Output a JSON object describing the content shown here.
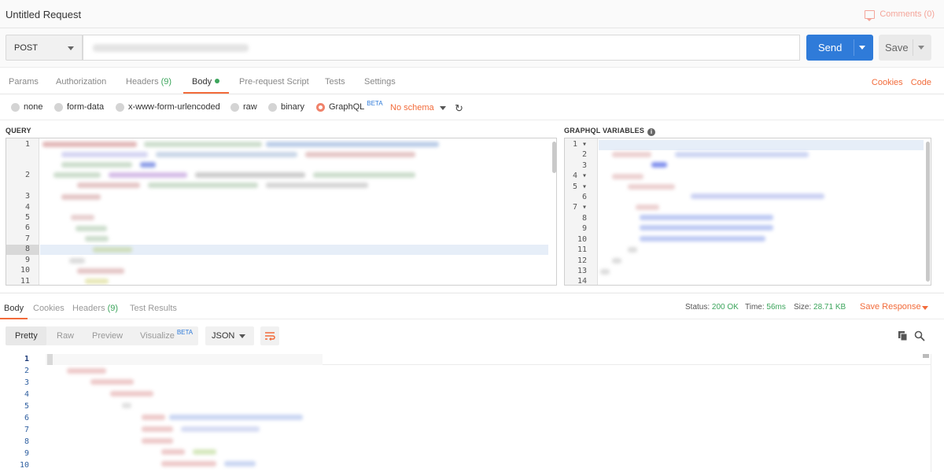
{
  "header": {
    "title": "Untitled Request",
    "comments_label": "Comments (0)"
  },
  "request": {
    "method": "POST",
    "url_value": "",
    "send_label": "Send",
    "save_label": "Save"
  },
  "request_tabs": [
    {
      "label": "Params"
    },
    {
      "label": "Authorization"
    },
    {
      "label": "Headers",
      "count": "(9)"
    },
    {
      "label": "Body",
      "active": true
    },
    {
      "label": "Pre-request Script"
    },
    {
      "label": "Tests"
    },
    {
      "label": "Settings"
    }
  ],
  "right_links": {
    "cookies": "Cookies",
    "code": "Code"
  },
  "body_types": [
    {
      "label": "none"
    },
    {
      "label": "form-data"
    },
    {
      "label": "x-www-form-urlencoded"
    },
    {
      "label": "raw"
    },
    {
      "label": "binary"
    },
    {
      "label": "GraphQL",
      "selected": true,
      "badge": "BETA"
    }
  ],
  "schema": {
    "label": "No schema"
  },
  "query_editor": {
    "label": "QUERY",
    "line_numbers": [
      "1",
      "2",
      "3",
      "4",
      "5",
      "6",
      "7",
      "8",
      "9",
      "10",
      "11"
    ],
    "active_line": "8"
  },
  "variables_editor": {
    "label": "GRAPHQL VARIABLES",
    "line_numbers": [
      "1",
      "2",
      "3",
      "4",
      "5",
      "6",
      "7",
      "8",
      "9",
      "10",
      "11",
      "12",
      "13",
      "14"
    ],
    "folds": [
      "1",
      "4",
      "5",
      "7"
    ]
  },
  "response_tabs": [
    {
      "label": "Body",
      "active": true
    },
    {
      "label": "Cookies"
    },
    {
      "label": "Headers",
      "count": "(9)"
    },
    {
      "label": "Test Results"
    }
  ],
  "response_status": {
    "status_label": "Status:",
    "status_value": "200 OK",
    "time_label": "Time:",
    "time_value": "56ms",
    "size_label": "Size:",
    "size_value": "28.71 KB"
  },
  "save_response_label": "Save Response",
  "view_modes": [
    {
      "label": "Pretty",
      "active": true
    },
    {
      "label": "Raw"
    },
    {
      "label": "Preview"
    },
    {
      "label": "Visualize",
      "badge": "BETA"
    }
  ],
  "format": {
    "label": "JSON"
  },
  "response_body": {
    "line_numbers": [
      "1",
      "2",
      "3",
      "4",
      "5",
      "6",
      "7",
      "8",
      "9",
      "10"
    ]
  },
  "colors": {
    "accent": "#f26b3a",
    "send_button": "#2f7bd9",
    "status_ok": "#3ca55c"
  },
  "icons": [
    "comment-icon",
    "caret-down-icon",
    "refresh-icon",
    "info-icon",
    "wrap-lines-icon",
    "copy-icon",
    "search-icon"
  ]
}
